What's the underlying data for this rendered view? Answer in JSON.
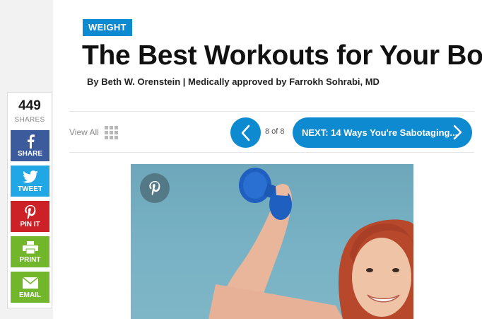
{
  "share": {
    "count": "449",
    "count_label": "SHARES",
    "buttons": [
      {
        "label": "SHARE",
        "icon": "facebook-icon",
        "color": "#3b5b9c"
      },
      {
        "label": "TWEET",
        "icon": "twitter-bird-icon",
        "color": "#21a6e6"
      },
      {
        "label": "PIN IT",
        "icon": "pinterest-icon",
        "color": "#cc2127"
      },
      {
        "label": "PRINT",
        "icon": "printer-icon",
        "color": "#72b62b"
      },
      {
        "label": "EMAIL",
        "icon": "envelope-icon",
        "color": "#72b62b"
      }
    ]
  },
  "article": {
    "category": "WEIGHT",
    "title": "The Best Workouts for Your Body Type",
    "byline": "By Beth W. Orenstein | Medically approved by Farrokh Sohrabi, MD"
  },
  "nav": {
    "view_all_label": "View All",
    "page_indicator": "8 of 8",
    "next_label": "NEXT: 14 Ways You're Sabotaging...",
    "prev_icon": "chevron-left-icon",
    "next_icon": "chevron-right-icon"
  },
  "image": {
    "overlay_icon": "pinterest-icon",
    "subject": "red-haired woman lifting a blue dumbbell"
  },
  "colors": {
    "accent": "#0d8ad0",
    "facebook": "#3b5b9c",
    "twitter": "#21a6e6",
    "pinterest": "#cc2127",
    "green": "#72b62b"
  }
}
